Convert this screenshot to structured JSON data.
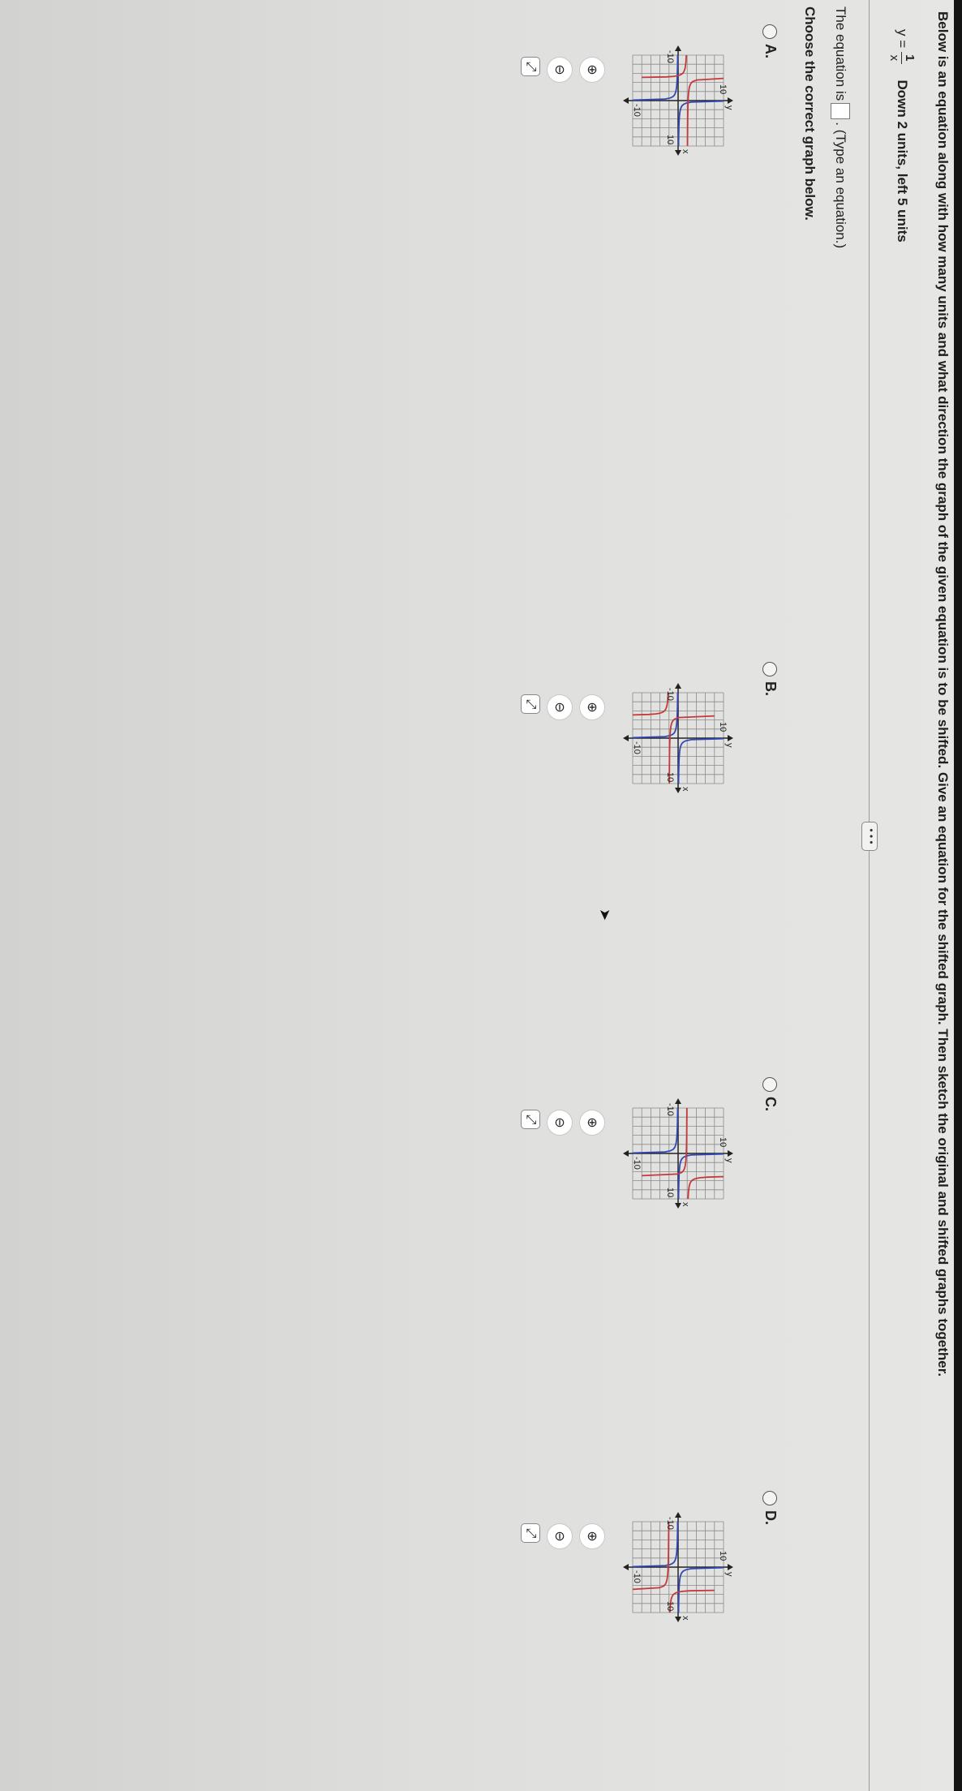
{
  "question": {
    "prompt": "Below is an equation along with how many units and what direction the graph of the given equation is to be shifted. Give an equation for the shifted graph. Then sketch the original and shifted graphs together.",
    "equation_lhs": "y =",
    "equation_numerator": "1",
    "equation_denominator": "x",
    "shift": "Down 2 units, left 5 units"
  },
  "more_button_label": "• • •",
  "answer_line": {
    "prefix": "The equation is",
    "suffix": ". (Type an equation.)"
  },
  "choose_prompt": "Choose the correct graph below.",
  "options": [
    {
      "label": "A.",
      "y_axis": "y",
      "x_axis": "x",
      "top_tick": "10",
      "left_tick": "-10",
      "right_tick": "10",
      "bottom_tick": "-10"
    },
    {
      "label": "B.",
      "y_axis": "y",
      "x_axis": "x",
      "top_tick": "10",
      "left_tick": "-10",
      "right_tick": "10",
      "bottom_tick": "-10"
    },
    {
      "label": "C.",
      "y_axis": "y",
      "x_axis": "x",
      "top_tick": "10",
      "left_tick": "-10",
      "right_tick": "10",
      "bottom_tick": "-10"
    },
    {
      "label": "D.",
      "y_axis": "y",
      "x_axis": "x",
      "top_tick": "10",
      "left_tick": "-10",
      "right_tick": "10",
      "bottom_tick": "-10"
    }
  ],
  "icons": [
    "zoom-in-icon",
    "zoom-out-icon",
    "popout-icon",
    "pointer-cursor-icon"
  ],
  "colors": {
    "original_curve": "#3048b8",
    "shifted_curve": "#c43a3a",
    "grid": "#8a8a8a"
  }
}
